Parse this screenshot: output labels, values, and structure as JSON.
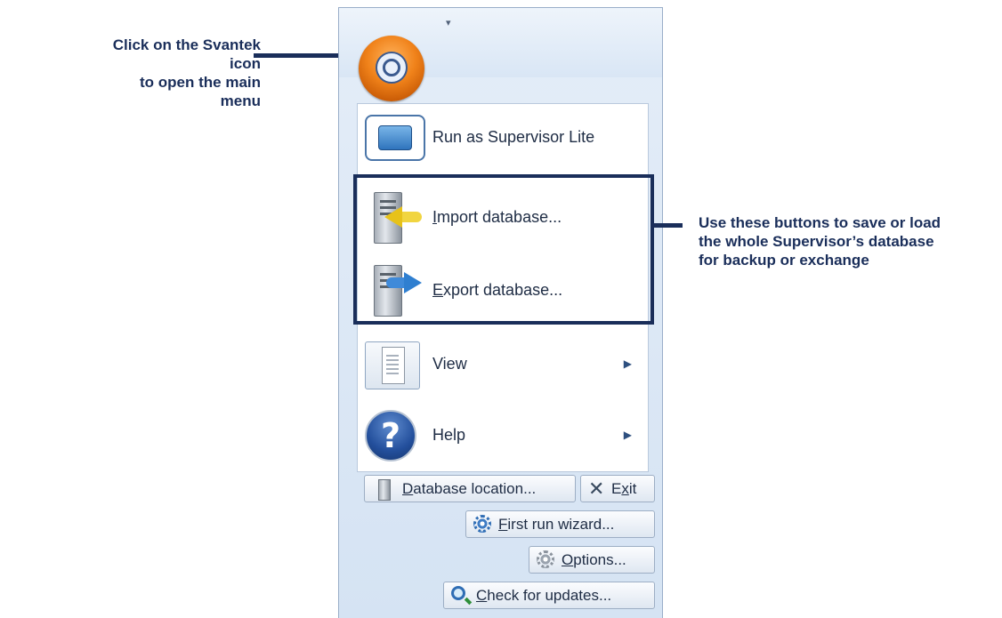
{
  "callouts": {
    "left": [
      "Click on the Svantek icon",
      "to open the main menu"
    ],
    "right": [
      "Use these buttons to save or load",
      "the whole Supervisor’s database",
      "for backup or exchange"
    ]
  },
  "menu": {
    "items": [
      {
        "label": "Run as Supervisor Lite",
        "icon": "monitor-icon"
      },
      {
        "label_accel": "I",
        "label_rest": "mport database...",
        "icon": "import-database-icon"
      },
      {
        "label_accel": "E",
        "label_rest": "xport database...",
        "icon": "export-database-icon"
      },
      {
        "label": "View",
        "icon": "view-page-icon",
        "submenu": true
      },
      {
        "label": "Help",
        "icon": "help-icon",
        "submenu": true
      }
    ]
  },
  "buttons": {
    "database_location": {
      "accel": "D",
      "rest": "atabase location..."
    },
    "exit": {
      "pre": "E",
      "accel": "x",
      "rest": "it"
    },
    "first_run_wizard": {
      "accel": "F",
      "rest": "irst run wizard..."
    },
    "options": {
      "accel": "O",
      "rest": "ptions..."
    },
    "check_for_updates": {
      "accel": "C",
      "rest": "heck for updates..."
    }
  },
  "colors": {
    "annotation": "#1a2e5a",
    "orb": "#f0821a"
  }
}
